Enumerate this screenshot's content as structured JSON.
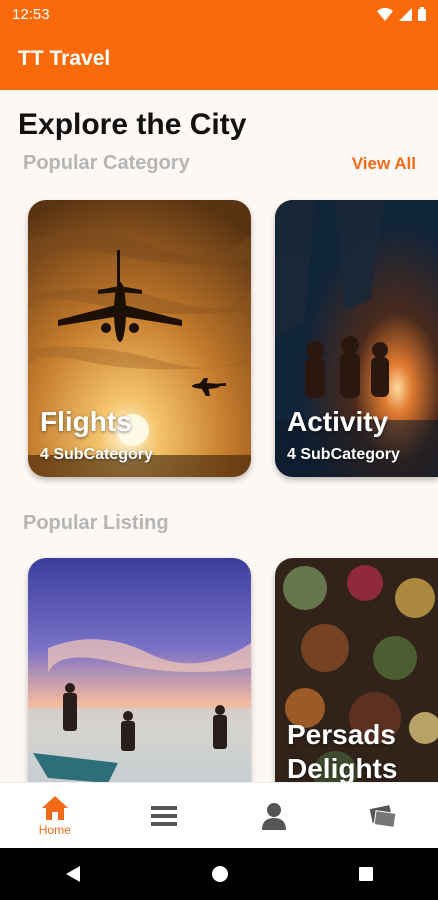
{
  "status_bar": {
    "time": "12:53",
    "icons": [
      "wifi-icon",
      "signal-icon",
      "battery-icon"
    ]
  },
  "app_bar": {
    "title": "TT Travel"
  },
  "main": {
    "page_title": "Explore the City",
    "popular_category": {
      "heading": "Popular Category",
      "view_all": "View All",
      "cards": [
        {
          "title": "Flights",
          "subtitle": "4 SubCategory"
        },
        {
          "title": "Activity",
          "subtitle": "4 SubCategory"
        }
      ]
    },
    "popular_listing": {
      "heading": "Popular Listing",
      "cards": [
        {
          "title": ""
        },
        {
          "title": "Persads Delights"
        }
      ]
    }
  },
  "bottom_nav": {
    "items": [
      {
        "label": "Home",
        "icon": "home-icon",
        "active": true
      },
      {
        "label": "",
        "icon": "menu-icon"
      },
      {
        "label": "",
        "icon": "profile-icon"
      },
      {
        "label": "",
        "icon": "tickets-icon"
      }
    ]
  },
  "system_nav": [
    "back-icon",
    "home-circle-icon",
    "recents-icon"
  ],
  "colors": {
    "accent": "#fa6a0a",
    "accent_text": "#f26a18",
    "background": "#fdf8f4",
    "muted_heading": "#b5b5b5"
  }
}
